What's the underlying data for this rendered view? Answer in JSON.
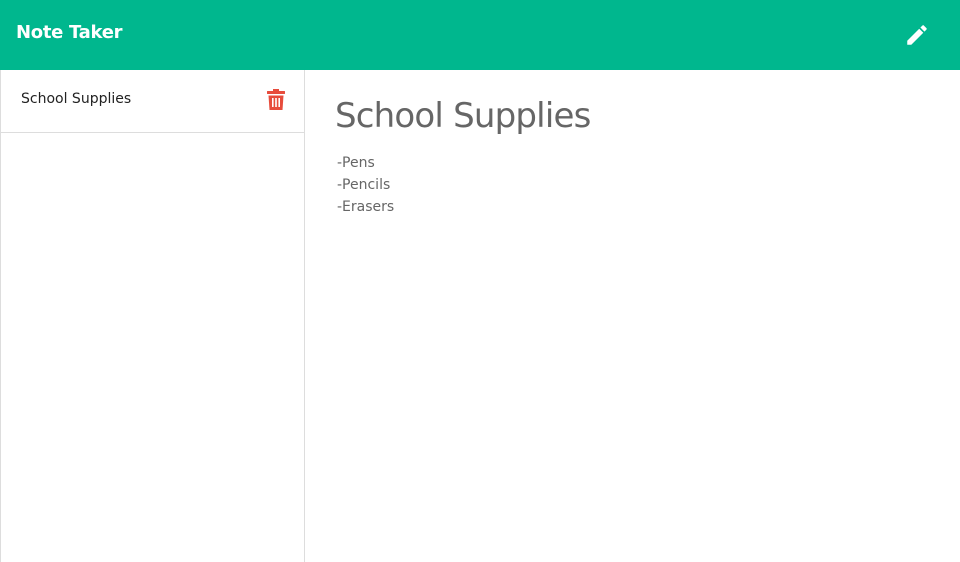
{
  "app": {
    "title": "Note Taker",
    "accent_color": "#00b78e",
    "new_note_icon": "pencil-icon"
  },
  "sidebar": {
    "notes": [
      {
        "title": "School Supplies",
        "delete_icon": "trash-icon",
        "delete_icon_color": "#e74c3c"
      }
    ]
  },
  "editor": {
    "title": "School Supplies",
    "text": "-Pens\n-Pencils\n-Erasers"
  }
}
